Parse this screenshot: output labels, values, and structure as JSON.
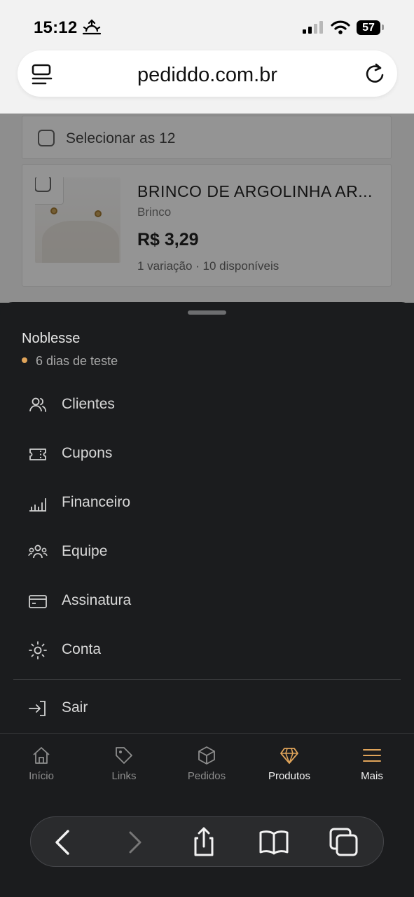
{
  "status_bar": {
    "time": "15:12",
    "battery": "57"
  },
  "browser": {
    "url": "pediddo.com.br"
  },
  "page": {
    "select_all_label": "Selecionar as 12",
    "product": {
      "name": "BRINCO DE ARGOLINHA AR...",
      "category": "Brinco",
      "price": "R$ 3,29",
      "stock": "1 variação · 10 disponíveis"
    }
  },
  "sheet": {
    "store_name": "Noblesse",
    "trial": "6 dias de teste",
    "menu": [
      {
        "label": "Clientes",
        "icon": "users-icon"
      },
      {
        "label": "Cupons",
        "icon": "ticket-icon"
      },
      {
        "label": "Financeiro",
        "icon": "bar-chart-icon"
      },
      {
        "label": "Equipe",
        "icon": "team-icon"
      },
      {
        "label": "Assinatura",
        "icon": "credit-card-icon"
      },
      {
        "label": "Conta",
        "icon": "sun-icon"
      }
    ],
    "logout": {
      "label": "Sair",
      "icon": "logout-icon"
    }
  },
  "tabs": [
    {
      "label": "Início",
      "icon": "home-icon"
    },
    {
      "label": "Links",
      "icon": "tag-icon"
    },
    {
      "label": "Pedidos",
      "icon": "box-icon"
    },
    {
      "label": "Produtos",
      "icon": "diamond-icon",
      "active": true
    },
    {
      "label": "Mais",
      "icon": "menu-icon"
    }
  ],
  "colors": {
    "accent": "#e0a45a",
    "sheet_bg": "#1b1c1e",
    "chrome_bg": "#f2f2f2"
  }
}
